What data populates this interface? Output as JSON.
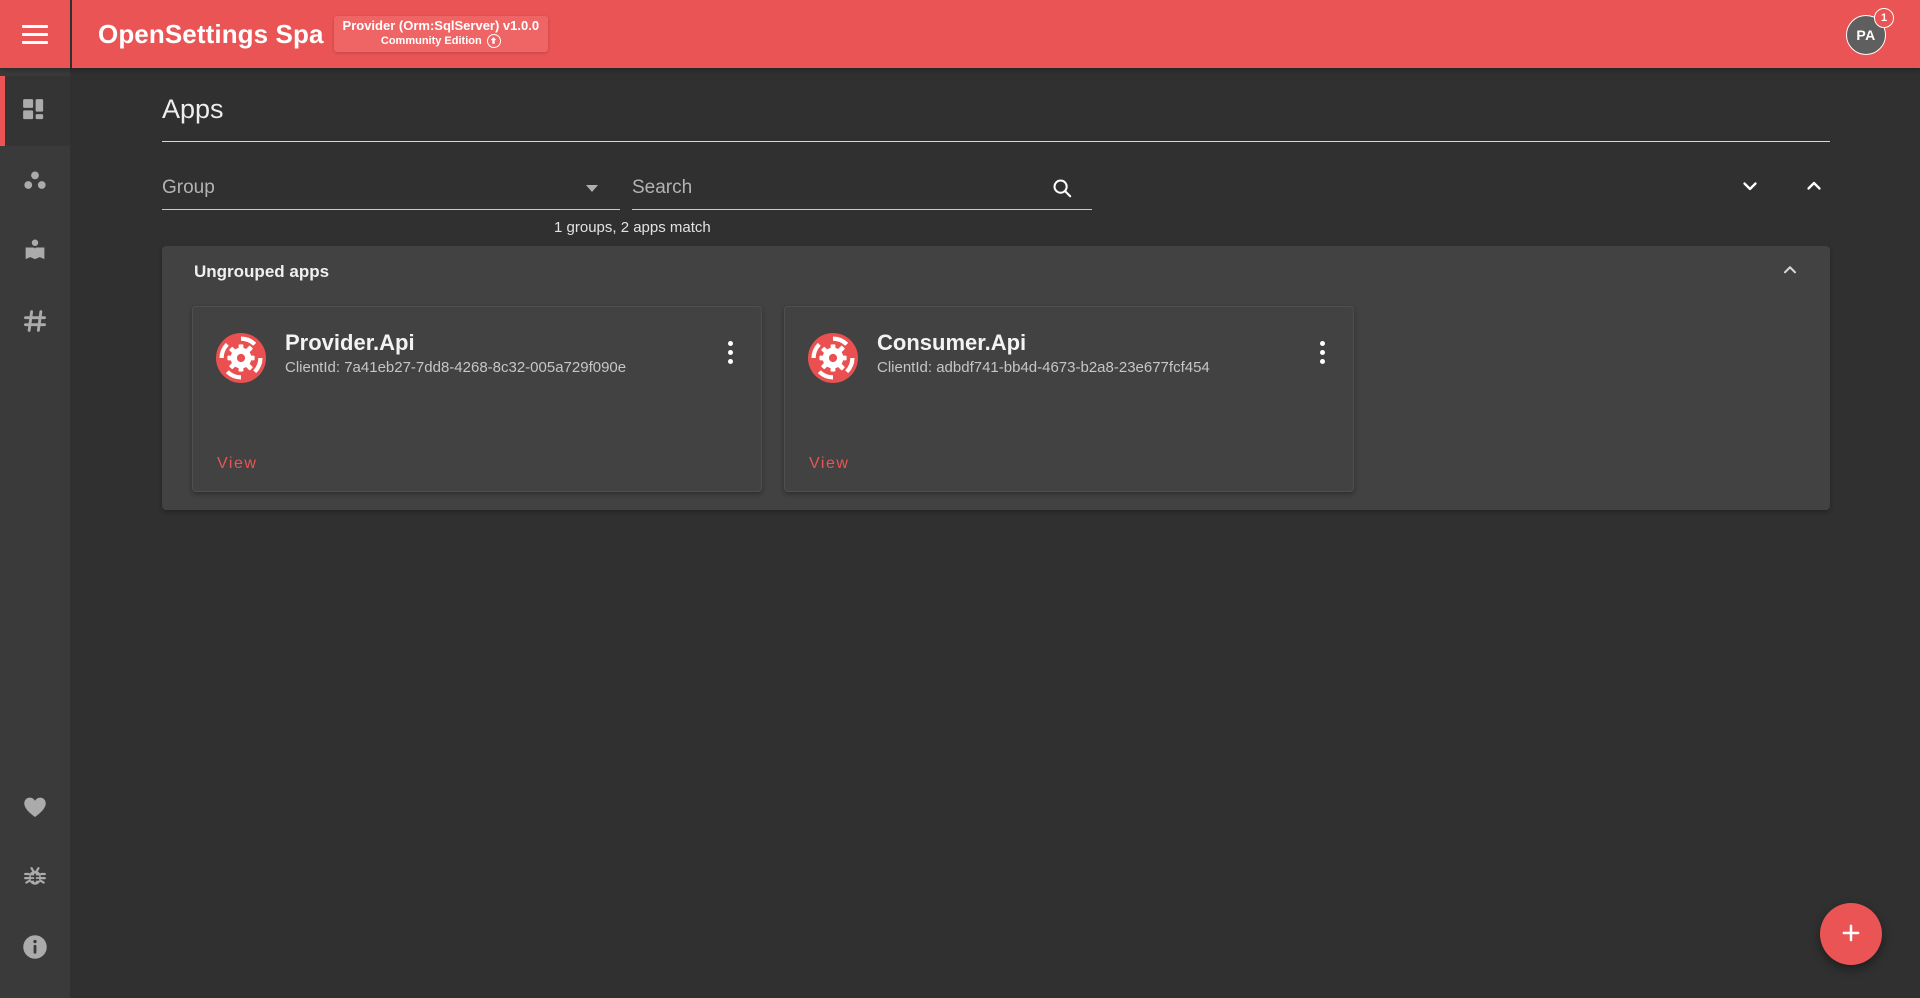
{
  "header": {
    "menu_icon": "hamburger-icon",
    "app_title": "OpenSettings Spa",
    "version_chip": {
      "line1": "Provider (Orm:SqlServer) v1.0.0",
      "line2": "Community Edition",
      "badge_icon": "arrow-up-circle-icon"
    },
    "avatar": {
      "initials": "PA",
      "badge": "1"
    },
    "accent_color": "#ea5455",
    "header_bg": "#ea5455"
  },
  "sidebar": {
    "bg": "#3a3a3a",
    "items": [
      {
        "name": "dashboard",
        "icon": "dashboard-grid-icon",
        "active": true
      },
      {
        "name": "groups",
        "icon": "group-dots-icon",
        "active": false
      },
      {
        "name": "library",
        "icon": "open-book-icon",
        "active": false
      },
      {
        "name": "tags",
        "icon": "hash-icon",
        "active": false
      }
    ],
    "bottom_items": [
      {
        "name": "favorites",
        "icon": "heart-icon"
      },
      {
        "name": "report-bug",
        "icon": "bug-icon"
      },
      {
        "name": "about",
        "icon": "info-circle-icon"
      }
    ]
  },
  "main": {
    "page_title": "Apps",
    "filters": {
      "group_label": "Group",
      "group_value": "",
      "search_placeholder": "Search",
      "search_value": "",
      "search_icon": "search-icon",
      "match_hint": "1 groups, 2 apps match",
      "expand_all_icon": "chevron-down-icon",
      "collapse_all_icon": "chevron-up-icon"
    },
    "group_panel": {
      "title": "Ungrouped apps",
      "collapse_icon": "chevron-up-icon",
      "cards": [
        {
          "name": "Provider.Api",
          "client_id_label": "ClientId:",
          "client_id": "7a41eb27-7dd8-4268-8c32-005a729f090e",
          "client_id_full": "ClientId: 7a41eb27-7dd8-4268-8c32-005a729f090e",
          "view_label": "View",
          "menu_icon": "kebab-menu-icon",
          "app_icon": "gear-target-icon"
        },
        {
          "name": "Consumer.Api",
          "client_id_label": "ClientId:",
          "client_id": "adbdf741-bb4d-4673-b2a8-23e677fcf454",
          "client_id_full": "ClientId: adbdf741-bb4d-4673-b2a8-23e677fcf454",
          "view_label": "View",
          "menu_icon": "kebab-menu-icon",
          "app_icon": "gear-target-icon"
        }
      ]
    },
    "fab": {
      "icon": "plus-icon",
      "label": "+"
    }
  },
  "colors": {
    "page_bg": "#303030",
    "panel_bg": "#424242",
    "accent": "#ea5455",
    "text_primary": "#f0f0f0",
    "text_secondary": "#c6c6c6"
  }
}
